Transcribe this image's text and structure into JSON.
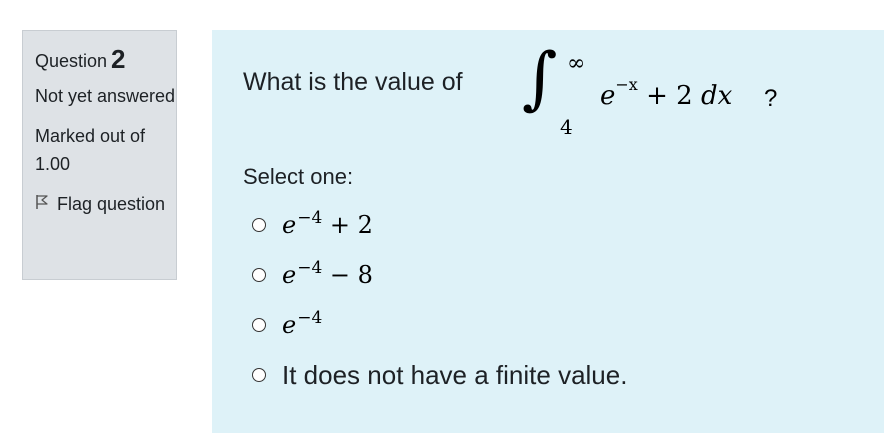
{
  "info": {
    "question_label": "Question",
    "question_number": "2",
    "state": "Not yet answered",
    "grade": "Marked out of 1.00",
    "flag_label": "Flag question"
  },
  "question": {
    "text": "What is the value of",
    "integral": {
      "upper": "∞",
      "lower": "4",
      "integrand_base": "e",
      "integrand_exponent": "−x",
      "integrand_rest": "+ 2",
      "differential": "dx",
      "question_mark": "?"
    },
    "prompt": "Select one:",
    "options": [
      {
        "base": "e",
        "exponent": "−4",
        "rest": "+ 2"
      },
      {
        "base": "e",
        "exponent": "−4",
        "rest": "− 8"
      },
      {
        "base": "e",
        "exponent": "−4",
        "rest": ""
      },
      {
        "text": "It does not have a finite value."
      }
    ]
  }
}
